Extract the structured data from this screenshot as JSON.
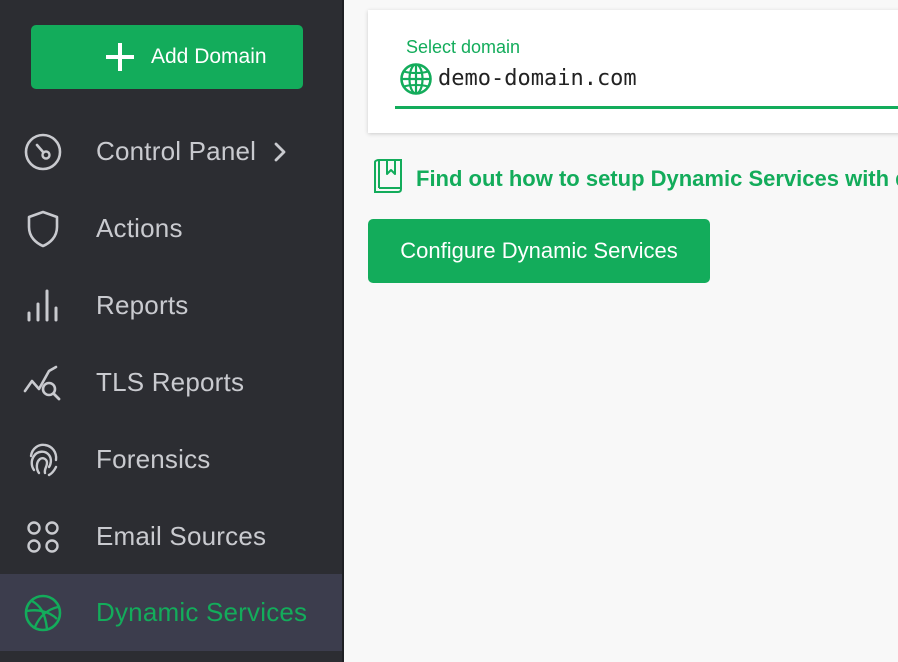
{
  "sidebar": {
    "add_domain_label": "Add Domain",
    "items": [
      {
        "label": "Control Panel",
        "icon": "speedometer-icon",
        "has_chevron": true
      },
      {
        "label": "Actions",
        "icon": "shield-icon"
      },
      {
        "label": "Reports",
        "icon": "bar-chart-icon"
      },
      {
        "label": "TLS Reports",
        "icon": "chart-search-icon"
      },
      {
        "label": "Forensics",
        "icon": "fingerprint-icon"
      },
      {
        "label": "Email Sources",
        "icon": "grid-dots-icon"
      },
      {
        "label": "Dynamic Services",
        "icon": "aperture-icon",
        "active": true
      }
    ]
  },
  "main": {
    "select_domain_label": "Select domain",
    "domain_value": "demo-domain.com",
    "help_link_text": "Find out how to setup Dynamic Services with d",
    "configure_button_label": "Configure Dynamic Services"
  },
  "colors": {
    "accent": "#13ac5b",
    "sidebar_bg": "#2c2d32",
    "sidebar_active_bg": "#3c3d4d",
    "sidebar_text": "#c9cacf",
    "content_bg": "#f8f8f8"
  }
}
